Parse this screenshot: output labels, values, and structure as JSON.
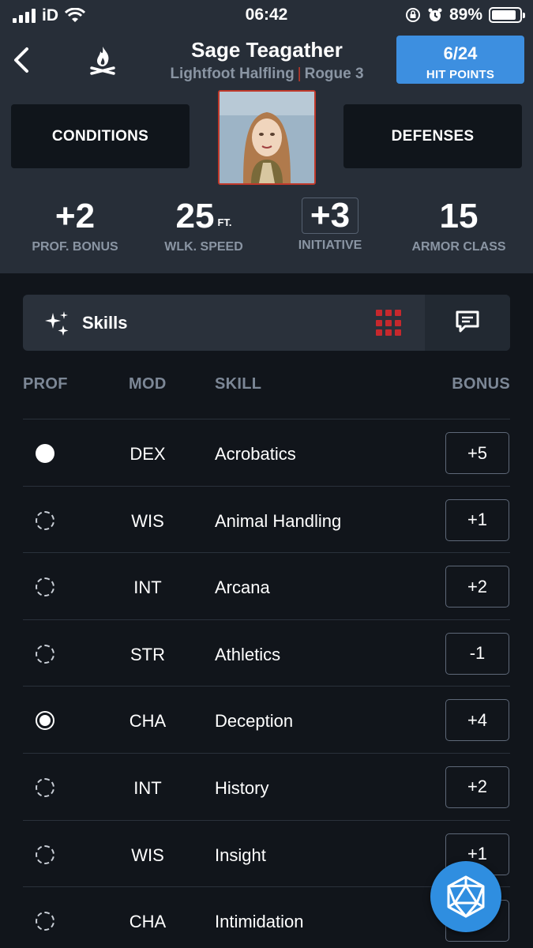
{
  "status_bar": {
    "carrier": "iD",
    "time": "06:42",
    "battery": "89%",
    "battery_level": 0.89
  },
  "header": {
    "name": "Sage Teagather",
    "race": "Lightfoot Halfling",
    "separator": "|",
    "class_level": "Rogue 3",
    "hp_value": "6/24",
    "hp_label": "HIT POINTS",
    "conditions_label": "CONDITIONS",
    "defenses_label": "DEFENSES"
  },
  "stats": {
    "prof_bonus": {
      "value": "+2",
      "label": "PROF. BONUS"
    },
    "walk_speed": {
      "value": "25",
      "unit": "FT.",
      "label": "WLK. SPEED"
    },
    "initiative": {
      "value": "+3",
      "label": "INITIATIVE"
    },
    "armor_class": {
      "value": "15",
      "label": "ARMOR CLASS"
    }
  },
  "skills_panel": {
    "title": "Skills"
  },
  "table": {
    "headers": {
      "prof": "PROF",
      "mod": "MOD",
      "skill": "SKILL",
      "bonus": "BONUS"
    },
    "rows": [
      {
        "prof": "full",
        "mod": "DEX",
        "skill": "Acrobatics",
        "bonus": "+5"
      },
      {
        "prof": "none",
        "mod": "WIS",
        "skill": "Animal Handling",
        "bonus": "+1"
      },
      {
        "prof": "none",
        "mod": "INT",
        "skill": "Arcana",
        "bonus": "+2"
      },
      {
        "prof": "none",
        "mod": "STR",
        "skill": "Athletics",
        "bonus": "-1"
      },
      {
        "prof": "half",
        "mod": "CHA",
        "skill": "Deception",
        "bonus": "+4"
      },
      {
        "prof": "none",
        "mod": "INT",
        "skill": "History",
        "bonus": "+2"
      },
      {
        "prof": "none",
        "mod": "WIS",
        "skill": "Insight",
        "bonus": "+1"
      },
      {
        "prof": "none",
        "mod": "CHA",
        "skill": "Intimidation",
        "bonus": ""
      }
    ]
  },
  "colors": {
    "hp_accent": "#3d8fe0",
    "brand_red": "#c6282d",
    "fab_blue": "#2f8ee0"
  },
  "icons": [
    "back-icon",
    "campfire-icon",
    "sparkle-icon",
    "grid-icon",
    "chat-icon",
    "d20-dice-icon"
  ]
}
